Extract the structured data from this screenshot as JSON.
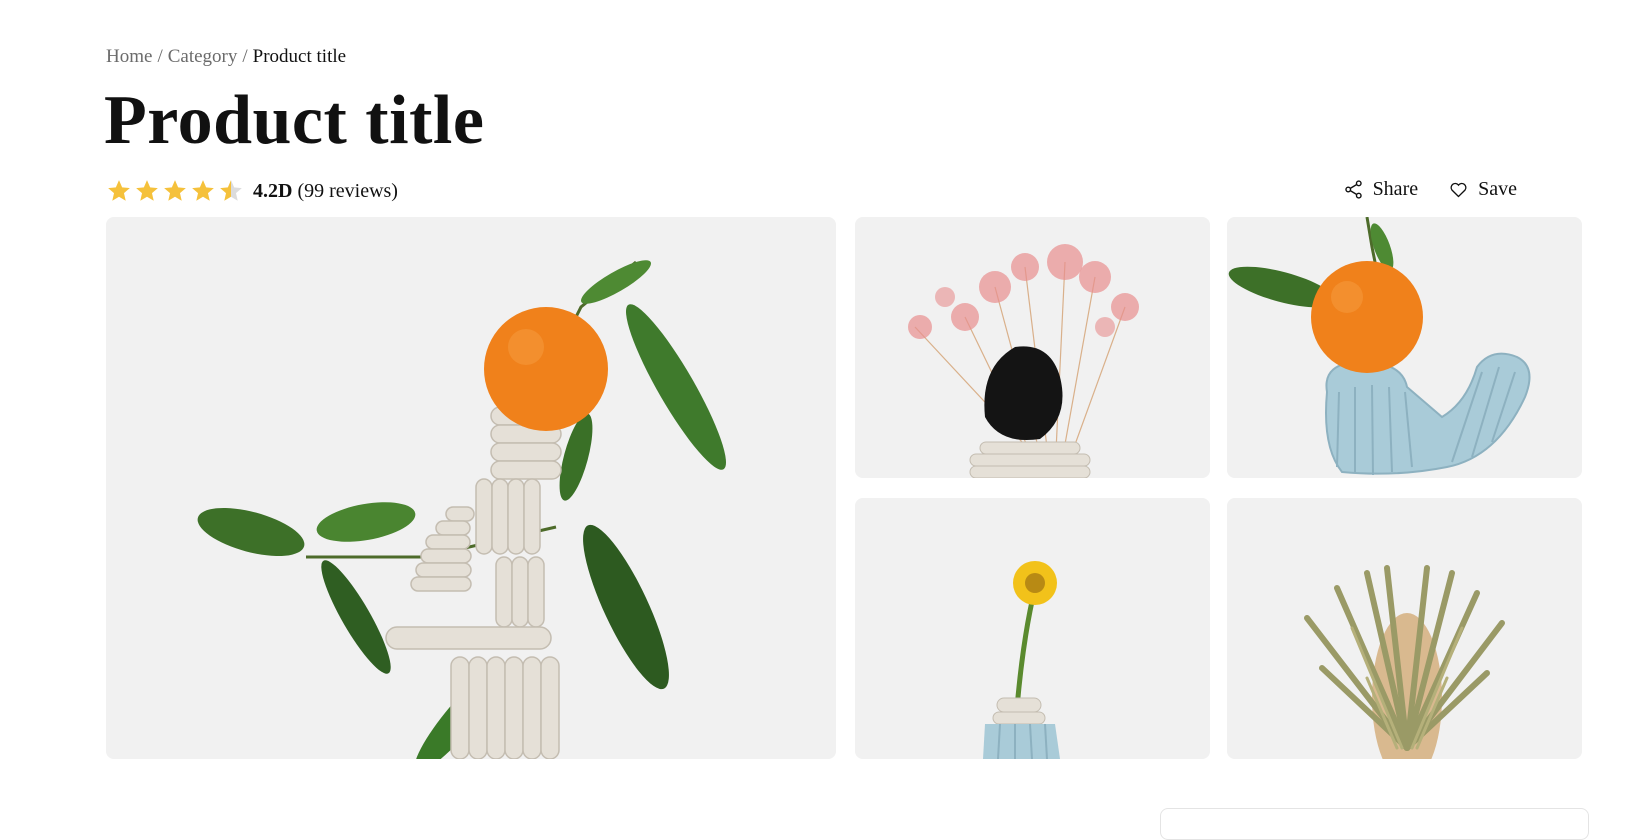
{
  "breadcrumb": {
    "home": "Home",
    "category": "Category",
    "separator": "/",
    "current": "Product title"
  },
  "product": {
    "title": "Product title",
    "rating": 4.5,
    "rating_label": "4.2D",
    "reviews_label": "(99 reviews)"
  },
  "actions": {
    "share_label": "Share",
    "save_label": "Save"
  },
  "gallery": {
    "images": [
      {
        "name": "orange on stacked clay sculpture with leaves"
      },
      {
        "name": "pink dried flowers with black clay rock"
      },
      {
        "name": "orange on blue ribbed clay piece"
      },
      {
        "name": "yellow flower in blue clay vase"
      },
      {
        "name": "dried banksia flower"
      }
    ]
  },
  "colors": {
    "star": "#f5c13b",
    "star_empty": "#dcdcdc",
    "breadcrumb_link": "#6b6b6b",
    "image_bg": "#f0f0f0"
  },
  "icons": {
    "share": "share-icon",
    "save": "heart-icon",
    "star": "star-icon"
  }
}
